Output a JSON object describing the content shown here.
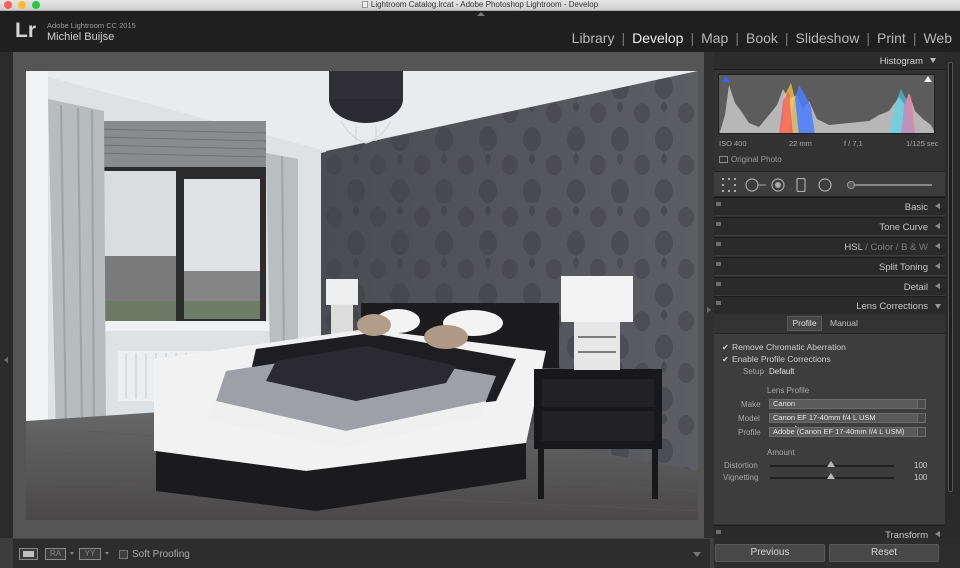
{
  "window": {
    "title": "Lightroom Catalog.lrcat - Adobe Photoshop Lightroom - Develop"
  },
  "identity": {
    "logo": "Lr",
    "version": "Adobe Lightroom CC 2015",
    "user": "Michiel Buijse"
  },
  "modules": [
    {
      "label": "Library",
      "active": false
    },
    {
      "label": "Develop",
      "active": true
    },
    {
      "label": "Map",
      "active": false
    },
    {
      "label": "Book",
      "active": false
    },
    {
      "label": "Slideshow",
      "active": false
    },
    {
      "label": "Print",
      "active": false
    },
    {
      "label": "Web",
      "active": false
    }
  ],
  "module_separator": "|",
  "histogram": {
    "title": "Histogram",
    "iso": "ISO 400",
    "focal": "22 mm",
    "aperture": "f / 7,1",
    "shutter": "1/125 sec",
    "original_photo": "Original Photo"
  },
  "panels": {
    "basic": "Basic",
    "tone_curve": "Tone Curve",
    "hsl": "HSL",
    "color": "Color",
    "bw": "B & W",
    "split_toning": "Split Toning",
    "detail": "Detail",
    "lens_corrections": "Lens Corrections",
    "transform": "Transform"
  },
  "lens": {
    "tab_profile": "Profile",
    "tab_manual": "Manual",
    "remove_ca": "Remove Chromatic Aberration",
    "enable_profile": "Enable Profile Corrections",
    "setup_label": "Setup",
    "setup_value": "Default",
    "lens_profile_heading": "Lens Profile",
    "make_label": "Make",
    "make_value": "Canon",
    "model_label": "Model",
    "model_value": "Canon EF 17-40mm f/4 L USM",
    "profile_label": "Profile",
    "profile_value": "Adobe (Canon EF 17-40mm f/4 L USM)",
    "amount_heading": "Amount",
    "distortion_label": "Distortion",
    "distortion_value": "100",
    "vignetting_label": "Vignetting",
    "vignetting_value": "100"
  },
  "toolbar": {
    "ra": "RA",
    "yy": "YY",
    "soft_proofing": "Soft Proofing"
  },
  "buttons": {
    "previous": "Previous",
    "reset": "Reset"
  }
}
